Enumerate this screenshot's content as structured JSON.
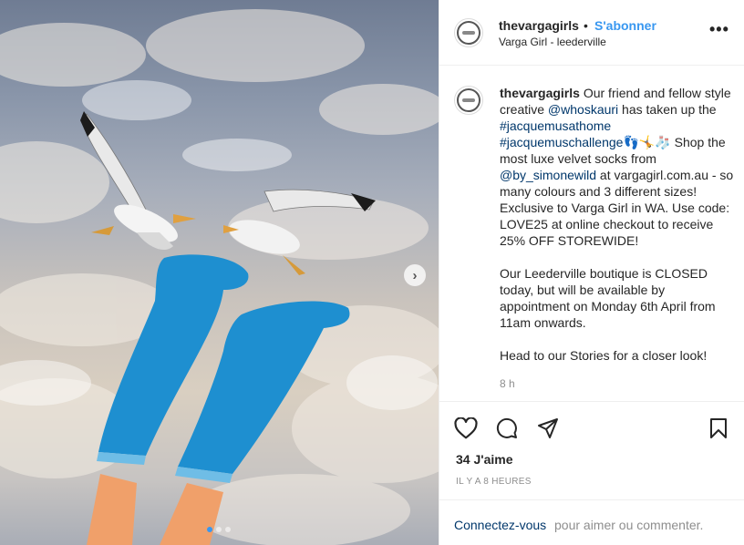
{
  "post": {
    "username": "thevargagirls",
    "separator": "•",
    "follow_label": "S'abonner",
    "location": "Varga Girl - leederville",
    "more_label": "•••"
  },
  "caption": {
    "username": "thevargagirls",
    "p1a": " Our friend and fellow style creative ",
    "mention1": "@whoskauri",
    "p1b": " has taken up the ",
    "hashtag1": "#jacquemusathome",
    "hashtag2": "#jacquemuschallenge",
    "emojis": "👣🤸🧦",
    "p1c": " Shop the most luxe velvet socks from ",
    "mention2": "@by_simonewild",
    "p1d": " at vargagirl.com.au - so many colours and 3 different sizes! Exclusive to Varga Girl in WA. Use code: LOVE25 at online checkout to receive 25% OFF STOREWIDE!",
    "p2": "Our Leederville boutique is CLOSED today, but will be available by appointment on Monday 6th April from 11am onwards.",
    "p3": "Head to our Stories for a closer look!",
    "time": "8 h"
  },
  "stats": {
    "likes": "34 J'aime",
    "posted": "IL Y A 8 HEURES"
  },
  "footer": {
    "login_link": "Connectez-vous",
    "login_rest": "pour aimer ou commenter."
  },
  "media": {
    "next_label": "›",
    "carousel_count": 3,
    "carousel_active": 1,
    "sock_color": "#1e8fd0"
  },
  "icons": [
    "heart-icon",
    "comment-icon",
    "share-icon",
    "bookmark-icon",
    "more-icon",
    "chevron-right-icon"
  ]
}
